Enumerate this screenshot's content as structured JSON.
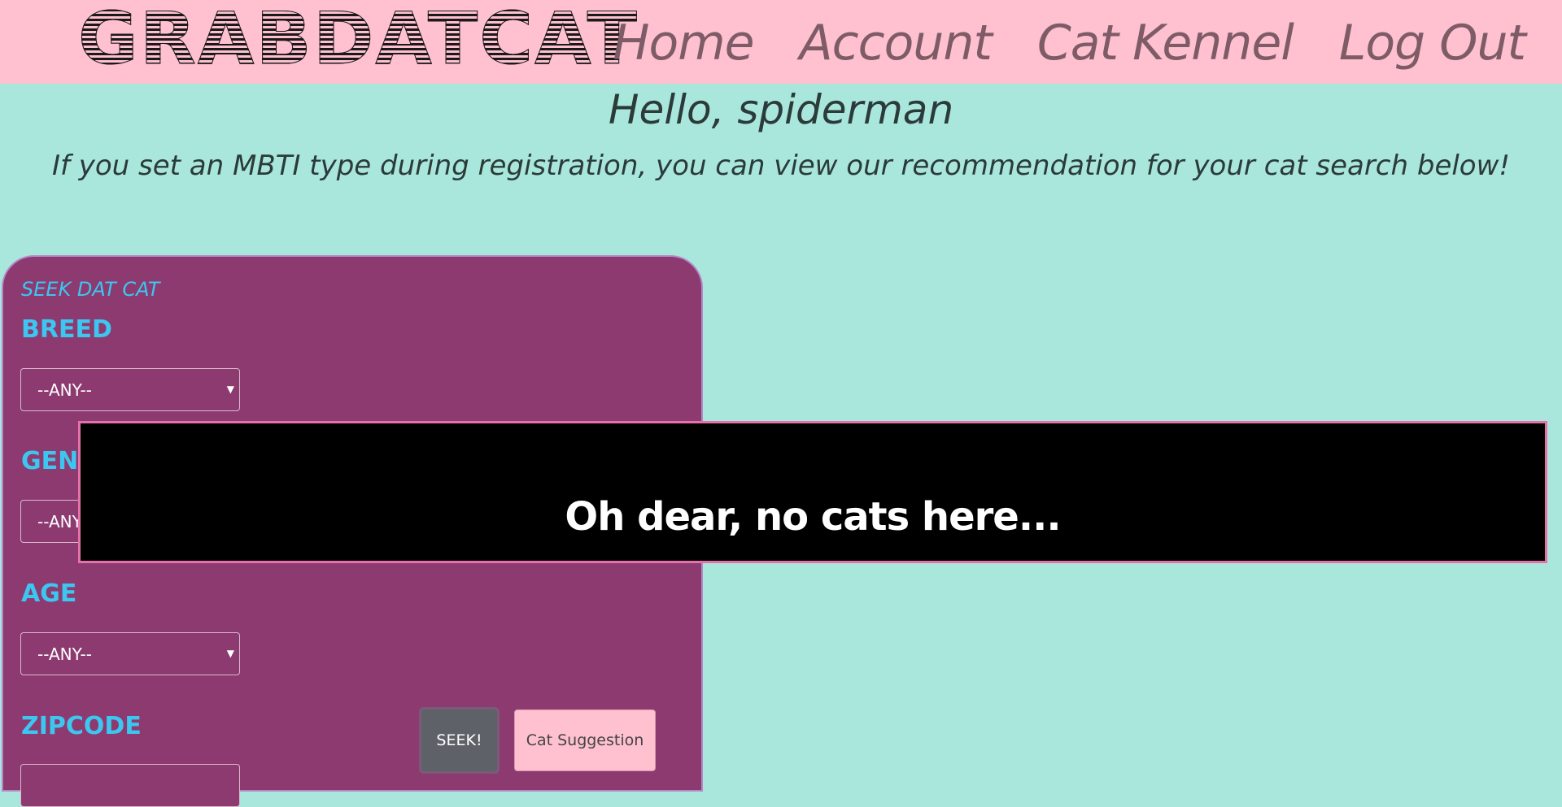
{
  "header": {
    "logo_text": "GRABDATCAT",
    "nav": [
      {
        "label": "Home"
      },
      {
        "label": "Account"
      },
      {
        "label": "Cat Kennel"
      },
      {
        "label": "Log Out"
      }
    ]
  },
  "main": {
    "greeting": "Hello, spiderman",
    "subtext": "If you set an MBTI type during registration, you can view our recommendation for your cat search below!"
  },
  "search_panel": {
    "title": "SEEK DAT CAT",
    "breed": {
      "label": "BREED",
      "value": "--ANY--"
    },
    "gender": {
      "label": "GENDER",
      "value": "--ANY--"
    },
    "age": {
      "label": "AGE",
      "value": "--ANY--"
    },
    "zipcode": {
      "label": "ZIPCODE"
    },
    "seek_label": "SEEK!",
    "suggestion_label": "Cat Suggestion"
  },
  "overlay": {
    "message": "Oh dear, no cats here..."
  },
  "colors": {
    "background": "#a9e7dc",
    "navbar": "#ffc0cf",
    "panel": "#8d3a70",
    "label": "#3cc7f0",
    "overlay_border": "#e671aa"
  }
}
